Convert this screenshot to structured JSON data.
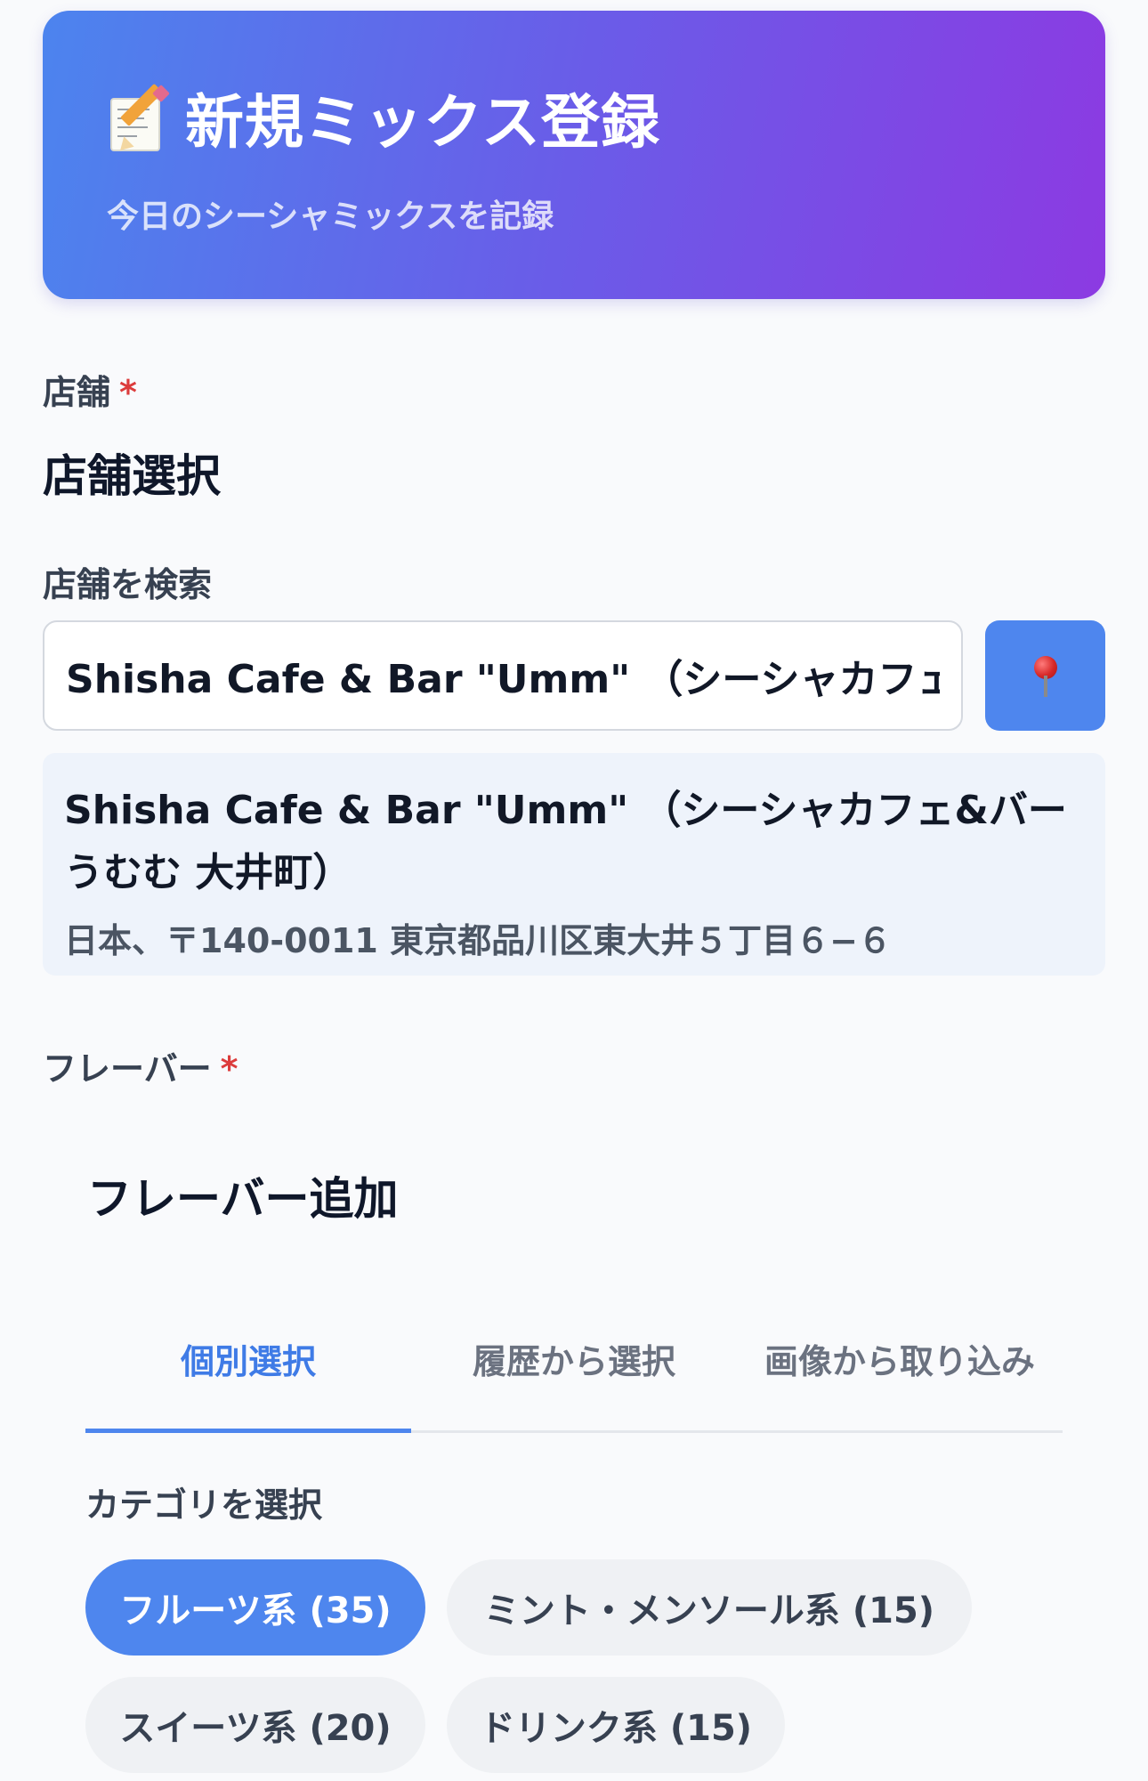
{
  "header": {
    "icon": "memo-icon",
    "title": "新規ミックス登録",
    "subtitle": "今日のシーシャミックスを記録"
  },
  "store": {
    "label": "店舗",
    "required_mark": "*",
    "section_title": "店舗選択",
    "search_label": "店舗を検索",
    "search_value": "Shisha Cafe & Bar \"Umm\" （シーシャカフェ&バー うむむ 大井町）",
    "location_button_icon": "pin-icon",
    "result": {
      "name": "Shisha Cafe & Bar \"Umm\" （シーシャカフェ&バー うむむ 大井町）",
      "address": "日本、〒140-0011 東京都品川区東大井５丁目６−６"
    }
  },
  "flavor": {
    "label": "フレーバー",
    "required_mark": "*",
    "section_title": "フレーバー追加",
    "tabs": [
      {
        "label": "個別選択",
        "active": true
      },
      {
        "label": "履歴から選択",
        "active": false
      },
      {
        "label": "画像から取り込み",
        "active": false
      }
    ],
    "category_label": "カテゴリを選択",
    "categories": [
      {
        "label": "フルーツ系 (35)",
        "active": true
      },
      {
        "label": "ミント・メンソール系 (15)",
        "active": false
      },
      {
        "label": "スイーツ系 (20)",
        "active": false
      },
      {
        "label": "ドリンク系 (15)",
        "active": false
      }
    ]
  },
  "colors": {
    "accent": "#4e86ee",
    "required": "#dc3c3c",
    "header_gradient_start": "#4c84ee",
    "header_gradient_end": "#8c3ae2"
  }
}
